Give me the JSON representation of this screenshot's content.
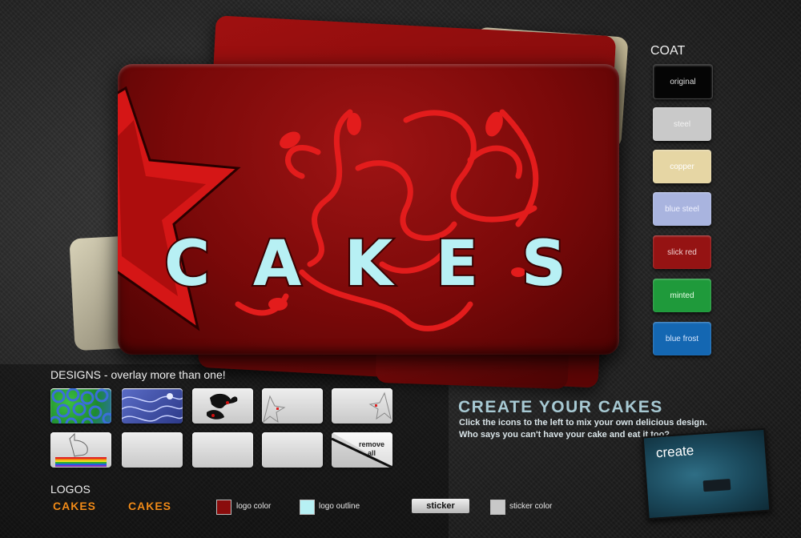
{
  "coat": {
    "title": "COAT",
    "options": [
      {
        "label": "original",
        "color": "#050505",
        "text_color": "#dddddd"
      },
      {
        "label": "steel",
        "color": "#c9c9c9",
        "text_color": "#f2f2f2"
      },
      {
        "label": "copper",
        "color": "#e6d6a4",
        "text_color": "#ffffff"
      },
      {
        "label": "blue steel",
        "color": "#a9b4df",
        "text_color": "#f0f2ff"
      },
      {
        "label": "slick red",
        "color": "#951313",
        "text_color": "#f0d0d0"
      },
      {
        "label": "minted",
        "color": "#1f9a3b",
        "text_color": "#e8ffe8"
      },
      {
        "label": "blue frost",
        "color": "#1467b2",
        "text_color": "#dbe9ff"
      }
    ]
  },
  "designs": {
    "title": "DESIGNS - overlay more than one!",
    "remove_label": "remove all"
  },
  "card": {
    "brand": "CAKES",
    "base_color": "#7a0909",
    "accent_color": "#e01818",
    "logo_fill": "#b7f0f4"
  },
  "create": {
    "title": "CREATE YOUR CAKES",
    "line1": "Click the icons to the left to mix your own delicious design.",
    "line2": "Who says you can't have your cake and eat it too?",
    "button_label": "create"
  },
  "logos": {
    "title": "LOGOS",
    "option1": "CAKES",
    "option2": "CAKES",
    "logo_color_label": "logo color",
    "logo_color_value": "#8a0c0c",
    "logo_outline_label": "logo outline",
    "logo_outline_value": "#b7f0f4",
    "sticker_label": "sticker",
    "sticker_color_label": "sticker color",
    "sticker_color_value": "#c8c8c8"
  }
}
